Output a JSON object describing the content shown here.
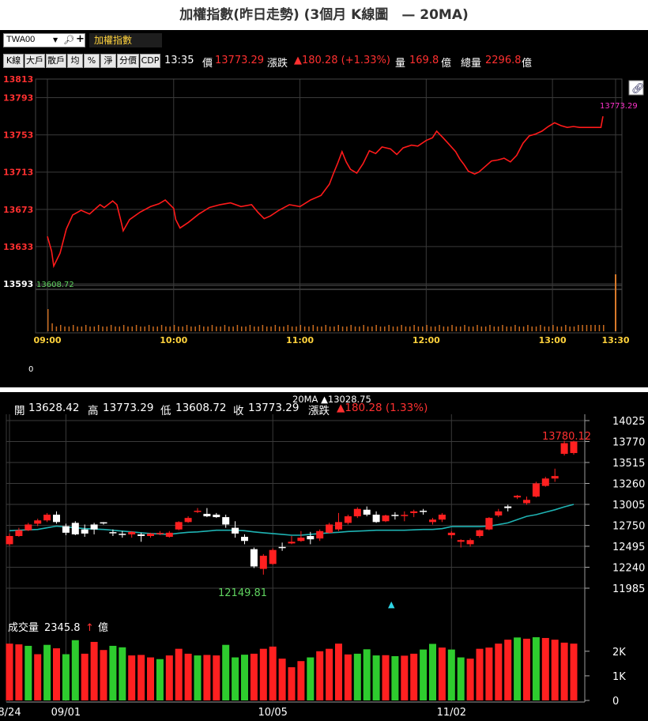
{
  "page": {
    "title": "加權指數(昨日走勢) (3個月 K線圖　— 20MA)"
  },
  "toolbar": {
    "symbol": "TWA00",
    "name": "加權指數",
    "icons": [
      "search-icon",
      "add-icon",
      "chevron-down-icon",
      "link-icon"
    ]
  },
  "buttons": [
    "K線",
    "大戶",
    "散戶",
    "均",
    "%",
    "淨",
    "分價",
    "CDP"
  ],
  "quote": {
    "time": "13:35",
    "price_label": "價",
    "price": "13773.29",
    "change_label": "漲跌",
    "change": "▲180.28 (+1.33%)",
    "volume_label": "量",
    "volume": "169.8",
    "volume_unit": "億",
    "total_volume_label": "總量",
    "total_volume": "2296.8",
    "total_volume_unit": "億"
  },
  "colors": {
    "up": "#ff2020",
    "down": "#2ecc2e",
    "ma": "#1fb3b3",
    "intraday_line": "#ff1a1a",
    "price_axis_text": "#ff3030",
    "green_text": "#5fd35f",
    "magenta_text": "#ff33cc"
  },
  "intraday_chart": {
    "type": "line",
    "y_ticks": [
      "13813",
      "13793",
      "13753",
      "13713",
      "13673",
      "13633",
      "13593"
    ],
    "ylim": [
      13593,
      13813
    ],
    "x_ticks": [
      "09:00",
      "10:00",
      "11:00",
      "12:00",
      "13:00",
      "13:30"
    ],
    "volume_axis_label": "0",
    "last_label": "13773.29",
    "prev_close_label": "13608.72",
    "points": [
      [
        "09:00",
        13644
      ],
      [
        "09:02",
        13628
      ],
      [
        "09:03",
        13612
      ],
      [
        "09:06",
        13626
      ],
      [
        "09:09",
        13652
      ],
      [
        "09:12",
        13667
      ],
      [
        "09:16",
        13672
      ],
      [
        "09:20",
        13668
      ],
      [
        "09:25",
        13678
      ],
      [
        "09:27",
        13675
      ],
      [
        "09:31",
        13682
      ],
      [
        "09:33",
        13678
      ],
      [
        "09:35",
        13660
      ],
      [
        "09:36",
        13650
      ],
      [
        "09:39",
        13662
      ],
      [
        "09:44",
        13670
      ],
      [
        "09:49",
        13676
      ],
      [
        "09:53",
        13679
      ],
      [
        "09:56",
        13683
      ],
      [
        "10:00",
        13674
      ],
      [
        "10:01",
        13662
      ],
      [
        "10:03",
        13653
      ],
      [
        "10:07",
        13659
      ],
      [
        "10:12",
        13668
      ],
      [
        "10:17",
        13675
      ],
      [
        "10:22",
        13678
      ],
      [
        "10:27",
        13680
      ],
      [
        "10:32",
        13676
      ],
      [
        "10:37",
        13678
      ],
      [
        "10:40",
        13670
      ],
      [
        "10:43",
        13663
      ],
      [
        "10:46",
        13666
      ],
      [
        "10:50",
        13672
      ],
      [
        "10:55",
        13678
      ],
      [
        "11:00",
        13676
      ],
      [
        "11:05",
        13683
      ],
      [
        "11:10",
        13688
      ],
      [
        "11:14",
        13700
      ],
      [
        "11:16",
        13712
      ],
      [
        "11:18",
        13723
      ],
      [
        "11:20",
        13735
      ],
      [
        "11:22",
        13724
      ],
      [
        "11:24",
        13716
      ],
      [
        "11:27",
        13712
      ],
      [
        "11:30",
        13722
      ],
      [
        "11:33",
        13736
      ],
      [
        "11:36",
        13733
      ],
      [
        "11:39",
        13740
      ],
      [
        "11:43",
        13738
      ],
      [
        "11:46",
        13732
      ],
      [
        "11:49",
        13739
      ],
      [
        "11:53",
        13742
      ],
      [
        "11:56",
        13741
      ],
      [
        "12:00",
        13747
      ],
      [
        "12:03",
        13750
      ],
      [
        "12:05",
        13757
      ],
      [
        "12:08",
        13750
      ],
      [
        "12:10",
        13745
      ],
      [
        "12:14",
        13735
      ],
      [
        "12:16",
        13727
      ],
      [
        "12:18",
        13721
      ],
      [
        "12:20",
        13714
      ],
      [
        "12:23",
        13711
      ],
      [
        "12:25",
        13713
      ],
      [
        "12:28",
        13719
      ],
      [
        "12:31",
        13725
      ],
      [
        "12:34",
        13726
      ],
      [
        "12:37",
        13728
      ],
      [
        "12:40",
        13724
      ],
      [
        "12:43",
        13731
      ],
      [
        "12:46",
        13744
      ],
      [
        "12:49",
        13752
      ],
      [
        "12:52",
        13754
      ],
      [
        "12:55",
        13757
      ],
      [
        "12:58",
        13762
      ],
      [
        "13:01",
        13766
      ],
      [
        "13:04",
        13763
      ],
      [
        "13:07",
        13761
      ],
      [
        "13:10",
        13762
      ],
      [
        "13:13",
        13761
      ],
      [
        "13:16",
        13761
      ],
      [
        "13:20",
        13761
      ],
      [
        "13:23",
        13761
      ],
      [
        "13:24",
        13773
      ]
    ],
    "ytick_colors": [
      "#ff3030",
      "#ff3030",
      "#ff3030",
      "#ff3030",
      "#ff3030",
      "#ff3030",
      "#ffffff"
    ]
  },
  "ohlc_header": {
    "open_label": "開",
    "open": "13628.42",
    "high_label": "高",
    "high": "13773.29",
    "low_label": "低",
    "low": "13608.72",
    "close_label": "收",
    "close": "13773.29",
    "change_label": "漲跌",
    "change": "▲180.28 (1.33%)",
    "ma_label": "20MA ▲13028.75"
  },
  "chart_data": {
    "type": "candlestick",
    "title": "加權指數(昨日走勢) (3個月 K線圖　— 20MA)",
    "price_ticks": [
      14025,
      13770,
      13515,
      13260,
      13005,
      12750,
      12495,
      12240,
      11985
    ],
    "price_axis_labels": [
      "14025",
      "13770",
      "13515",
      "13260",
      "13005",
      "12750",
      "12495",
      "12240",
      "11985"
    ],
    "ylim": [
      11985,
      14025
    ],
    "x_tick_labels": [
      {
        "label": "8/24",
        "index": 0
      },
      {
        "label": "09/01",
        "index": 6
      },
      {
        "label": "10/05",
        "index": 28
      },
      {
        "label": "11/02",
        "index": 47
      }
    ],
    "annotations": {
      "high": "13780.12",
      "low": "12149.81"
    },
    "volume_title": "成交量",
    "volume_value": "2345.8",
    "volume_unit": "億",
    "volume_ticks": [
      "2K",
      "1K",
      "0"
    ],
    "volume_ylim": [
      0,
      2700
    ],
    "candles": [
      {
        "o": 12520,
        "h": 12650,
        "l": 12500,
        "c": 12620,
        "v": 2310
      },
      {
        "o": 12620,
        "h": 12720,
        "l": 12610,
        "c": 12690,
        "v": 2280
      },
      {
        "o": 12690,
        "h": 12780,
        "l": 12680,
        "c": 12760,
        "v": 2220
      },
      {
        "o": 12770,
        "h": 12830,
        "l": 12740,
        "c": 12810,
        "v": 1880
      },
      {
        "o": 12810,
        "h": 12900,
        "l": 12790,
        "c": 12880,
        "v": 2260
      },
      {
        "o": 12880,
        "h": 12920,
        "l": 12770,
        "c": 12790,
        "v": 2120
      },
      {
        "o": 12740,
        "h": 12770,
        "l": 12630,
        "c": 12660,
        "v": 1880
      },
      {
        "o": 12780,
        "h": 12800,
        "l": 12630,
        "c": 12640,
        "v": 2450
      },
      {
        "o": 12700,
        "h": 12760,
        "l": 12610,
        "c": 12650,
        "v": 1900
      },
      {
        "o": 12760,
        "h": 12780,
        "l": 12640,
        "c": 12700,
        "v": 2380
      },
      {
        "o": 12780,
        "h": 12790,
        "l": 12760,
        "c": 12770,
        "v": 2050
      },
      {
        "o": 12660,
        "h": 12700,
        "l": 12620,
        "c": 12650,
        "v": 2220
      },
      {
        "o": 12640,
        "h": 12680,
        "l": 12600,
        "c": 12630,
        "v": 2160
      },
      {
        "o": 12640,
        "h": 12680,
        "l": 12600,
        "c": 12670,
        "v": 1830
      },
      {
        "o": 12640,
        "h": 12660,
        "l": 12550,
        "c": 12620,
        "v": 1850
      },
      {
        "o": 12620,
        "h": 12660,
        "l": 12600,
        "c": 12650,
        "v": 1750
      },
      {
        "o": 12650,
        "h": 12680,
        "l": 12630,
        "c": 12650,
        "v": 1680
      },
      {
        "o": 12610,
        "h": 12680,
        "l": 12600,
        "c": 12660,
        "v": 1830
      },
      {
        "o": 12700,
        "h": 12800,
        "l": 12690,
        "c": 12790,
        "v": 2100
      },
      {
        "o": 12790,
        "h": 12860,
        "l": 12780,
        "c": 12840,
        "v": 1900
      },
      {
        "o": 12920,
        "h": 12960,
        "l": 12900,
        "c": 12920,
        "v": 1830
      },
      {
        "o": 12890,
        "h": 12960,
        "l": 12850,
        "c": 12860,
        "v": 1850
      },
      {
        "o": 12880,
        "h": 12900,
        "l": 12840,
        "c": 12850,
        "v": 1830
      },
      {
        "o": 12850,
        "h": 12880,
        "l": 12720,
        "c": 12760,
        "v": 2260
      },
      {
        "o": 12720,
        "h": 12800,
        "l": 12600,
        "c": 12650,
        "v": 1750
      },
      {
        "o": 12610,
        "h": 12640,
        "l": 12520,
        "c": 12560,
        "v": 1860
      },
      {
        "o": 12460,
        "h": 12480,
        "l": 12230,
        "c": 12250,
        "v": 1900
      },
      {
        "o": 12220,
        "h": 12400,
        "l": 12150,
        "c": 12380,
        "v": 2100
      },
      {
        "o": 12280,
        "h": 12470,
        "l": 12270,
        "c": 12450,
        "v": 2190
      },
      {
        "o": 12480,
        "h": 12540,
        "l": 12440,
        "c": 12470,
        "v": 1700
      },
      {
        "o": 12530,
        "h": 12620,
        "l": 12520,
        "c": 12550,
        "v": 1350
      },
      {
        "o": 12560,
        "h": 12680,
        "l": 12550,
        "c": 12600,
        "v": 1600
      },
      {
        "o": 12620,
        "h": 12670,
        "l": 12520,
        "c": 12580,
        "v": 1750
      },
      {
        "o": 12590,
        "h": 12700,
        "l": 12560,
        "c": 12680,
        "v": 2000
      },
      {
        "o": 12660,
        "h": 12780,
        "l": 12650,
        "c": 12760,
        "v": 2100
      },
      {
        "o": 12700,
        "h": 12900,
        "l": 12680,
        "c": 12790,
        "v": 2310
      },
      {
        "o": 12780,
        "h": 12880,
        "l": 12760,
        "c": 12860,
        "v": 1870
      },
      {
        "o": 12860,
        "h": 12970,
        "l": 12840,
        "c": 12950,
        "v": 1900
      },
      {
        "o": 12940,
        "h": 12980,
        "l": 12860,
        "c": 12880,
        "v": 2080
      },
      {
        "o": 12880,
        "h": 12920,
        "l": 12780,
        "c": 12790,
        "v": 1830
      },
      {
        "o": 12800,
        "h": 12880,
        "l": 12790,
        "c": 12870,
        "v": 1840
      },
      {
        "o": 12870,
        "h": 12910,
        "l": 12820,
        "c": 12860,
        "v": 1800
      },
      {
        "o": 12860,
        "h": 12920,
        "l": 12800,
        "c": 12870,
        "v": 1820
      },
      {
        "o": 12900,
        "h": 12940,
        "l": 12850,
        "c": 12920,
        "v": 1900
      },
      {
        "o": 12920,
        "h": 12950,
        "l": 12880,
        "c": 12910,
        "v": 2070
      },
      {
        "o": 12790,
        "h": 12840,
        "l": 12760,
        "c": 12820,
        "v": 2300
      },
      {
        "o": 12820,
        "h": 12900,
        "l": 12790,
        "c": 12880,
        "v": 2150
      },
      {
        "o": 12630,
        "h": 12680,
        "l": 12590,
        "c": 12660,
        "v": 2070
      },
      {
        "o": 12550,
        "h": 12580,
        "l": 12480,
        "c": 12570,
        "v": 1750
      },
      {
        "o": 12520,
        "h": 12590,
        "l": 12490,
        "c": 12570,
        "v": 1700
      },
      {
        "o": 12620,
        "h": 12700,
        "l": 12600,
        "c": 12690,
        "v": 2100
      },
      {
        "o": 12700,
        "h": 12850,
        "l": 12690,
        "c": 12840,
        "v": 2150
      },
      {
        "o": 12870,
        "h": 12950,
        "l": 12850,
        "c": 12920,
        "v": 2310
      },
      {
        "o": 12980,
        "h": 13000,
        "l": 12920,
        "c": 12960,
        "v": 2470
      },
      {
        "o": 13090,
        "h": 13120,
        "l": 13070,
        "c": 13110,
        "v": 2560
      },
      {
        "o": 13020,
        "h": 13100,
        "l": 13000,
        "c": 13060,
        "v": 2510
      },
      {
        "o": 13100,
        "h": 13280,
        "l": 13090,
        "c": 13260,
        "v": 2570
      },
      {
        "o": 13230,
        "h": 13340,
        "l": 13220,
        "c": 13320,
        "v": 2540
      },
      {
        "o": 13320,
        "h": 13440,
        "l": 13280,
        "c": 13350,
        "v": 2470
      },
      {
        "o": 13620,
        "h": 13780,
        "l": 13600,
        "c": 13750,
        "v": 2350
      },
      {
        "o": 13630,
        "h": 13780,
        "l": 13610,
        "c": 13770,
        "v": 2310
      }
    ],
    "ma_values": [
      12685,
      12690,
      12695,
      12700,
      12720,
      12740,
      12730,
      12720,
      12710,
      12705,
      12700,
      12690,
      12680,
      12670,
      12660,
      12650,
      12645,
      12640,
      12655,
      12665,
      12670,
      12680,
      12690,
      12690,
      12690,
      12685,
      12670,
      12660,
      12650,
      12640,
      12630,
      12630,
      12640,
      12650,
      12660,
      12665,
      12675,
      12680,
      12685,
      12690,
      12690,
      12690,
      12690,
      12695,
      12700,
      12700,
      12710,
      12735,
      12735,
      12735,
      12735,
      12740,
      12760,
      12780,
      12820,
      12860,
      12880,
      12910,
      12940,
      12975,
      13005
    ],
    "volume_colors": [
      "up",
      "up",
      "down",
      "up",
      "down",
      "up",
      "down",
      "down",
      "up",
      "up",
      "up",
      "down",
      "down",
      "up",
      "up",
      "up",
      "down",
      "up",
      "up",
      "up",
      "down",
      "up",
      "up",
      "down",
      "down",
      "down",
      "up",
      "up",
      "up",
      "up",
      "up",
      "up",
      "down",
      "up",
      "up",
      "up",
      "up",
      "down",
      "down",
      "down",
      "up",
      "down",
      "up",
      "up",
      "down",
      "down",
      "up",
      "down",
      "down",
      "up",
      "up",
      "up",
      "up",
      "up",
      "down",
      "up",
      "down",
      "up",
      "up",
      "up",
      "up"
    ]
  }
}
